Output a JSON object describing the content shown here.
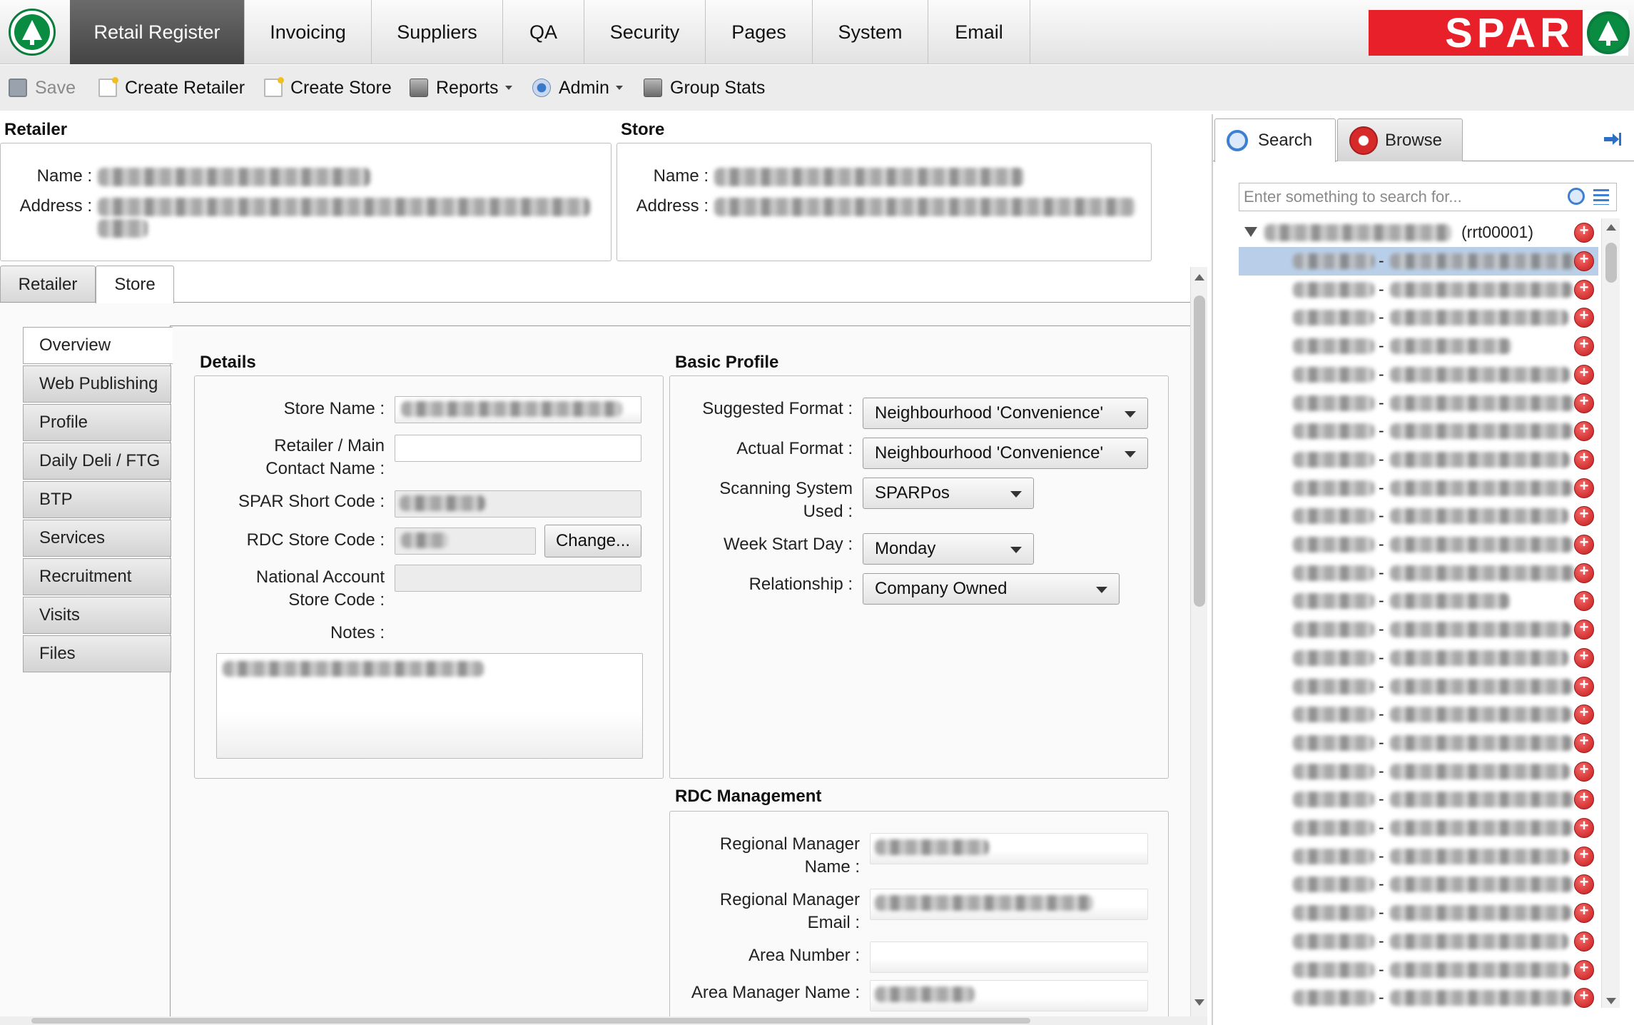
{
  "nav": {
    "tabs": [
      {
        "label": "Retail Register",
        "active": true
      },
      {
        "label": "Invoicing"
      },
      {
        "label": "Suppliers"
      },
      {
        "label": "QA"
      },
      {
        "label": "Security"
      },
      {
        "label": "Pages"
      },
      {
        "label": "System"
      },
      {
        "label": "Email"
      }
    ],
    "brand": "SPAR",
    "brand_color": "#e8202a",
    "logo_icon": "spar-tree-icon"
  },
  "toolbar": {
    "save": "Save",
    "create_retailer": "Create Retailer",
    "create_store": "Create Store",
    "reports": "Reports",
    "admin": "Admin",
    "group_stats": "Group Stats"
  },
  "retailer": {
    "title": "Retailer",
    "name_label": "Name :",
    "address_label": "Address :"
  },
  "store": {
    "title": "Store",
    "name_label": "Name :",
    "address_label": "Address :"
  },
  "main_tabs": [
    {
      "label": "Retailer"
    },
    {
      "label": "Store",
      "active": true
    }
  ],
  "side_tabs": [
    {
      "label": "Overview",
      "active": true
    },
    {
      "label": "Web Publishing"
    },
    {
      "label": "Profile"
    },
    {
      "label": "Daily Deli / FTG"
    },
    {
      "label": "BTP"
    },
    {
      "label": "Services"
    },
    {
      "label": "Recruitment"
    },
    {
      "label": "Visits"
    },
    {
      "label": "Files"
    }
  ],
  "details": {
    "title": "Details",
    "store_name_label": "Store Name :",
    "retailer_contact_label_1": "Retailer / Main",
    "retailer_contact_label_2": "Contact Name :",
    "short_code_label": "SPAR Short Code :",
    "rdc_code_label": "RDC Store Code :",
    "change_button": "Change...",
    "national_label_1": "National Account",
    "national_label_2": "Store Code :",
    "notes_label": "Notes :"
  },
  "basic_profile": {
    "title": "Basic Profile",
    "suggested_format_label": "Suggested Format :",
    "suggested_format_value": "Neighbourhood 'Convenience'",
    "actual_format_label": "Actual Format :",
    "actual_format_value": "Neighbourhood 'Convenience'",
    "scanning_label_1": "Scanning System",
    "scanning_label_2": "Used :",
    "scanning_value": "SPARPos",
    "week_start_label": "Week Start Day :",
    "week_start_value": "Monday",
    "relationship_label": "Relationship :",
    "relationship_value": "Company Owned"
  },
  "rdc_management": {
    "title": "RDC Management",
    "regional_name_label_1": "Regional Manager",
    "regional_name_label_2": "Name :",
    "regional_email_label_1": "Regional Manager",
    "regional_email_label_2": "Email :",
    "area_number_label": "Area Number :",
    "area_manager_label": "Area Manager Name :"
  },
  "right_panel": {
    "search_tab": "Search",
    "browse_tab": "Browse",
    "search_placeholder": "Enter something to search for...",
    "root_code": "(rrt00001)",
    "dash": "-"
  }
}
